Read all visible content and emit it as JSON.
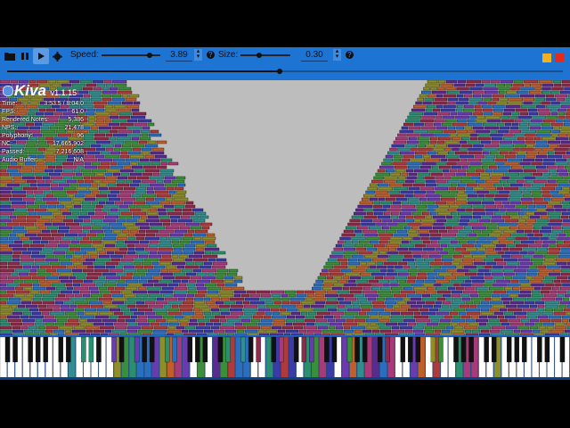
{
  "toolbar": {
    "speed_label": "Speed:",
    "speed_value": "3.89",
    "size_label": "Size:",
    "size_value": "0.30",
    "speed_fraction": 0.82,
    "size_fraction": 0.37,
    "seek_fraction": 0.49,
    "icons": [
      "folder-icon",
      "pause-icon",
      "play-icon",
      "gear-icon",
      "help-icon"
    ],
    "window_colors": {
      "minimize": "#f2b01e",
      "close": "#e42b1b"
    }
  },
  "overlay": {
    "app_name": "Kiva",
    "version": "v1.1.15",
    "stats": [
      {
        "label": "Time:",
        "value": "3:53.5 / 8:04.0"
      },
      {
        "label": "FPS:",
        "value": "61.0"
      },
      {
        "label": "Rendered Notes:",
        "value": "5,386"
      },
      {
        "label": "NPS:",
        "value": "21,478"
      },
      {
        "label": "Polyphony:",
        "value": "96"
      },
      {
        "label": "NC:",
        "value": "17,665,902"
      },
      {
        "label": "Passed:",
        "value": "7,216,608"
      },
      {
        "label": "Audio Buffer:",
        "value": "N/A"
      }
    ]
  },
  "colors": {
    "toolbar": "#1e74d2",
    "background": "#bdbdbd",
    "note_palette": [
      "#3a3aa8",
      "#a83a7a",
      "#2f8f8f",
      "#6a3ab0",
      "#3a8f3a",
      "#b03a3a",
      "#2a6fbf",
      "#8f8f2a",
      "#bf5f2a",
      "#5a2a8f",
      "#2a8f6f",
      "#8f2a4a"
    ]
  }
}
